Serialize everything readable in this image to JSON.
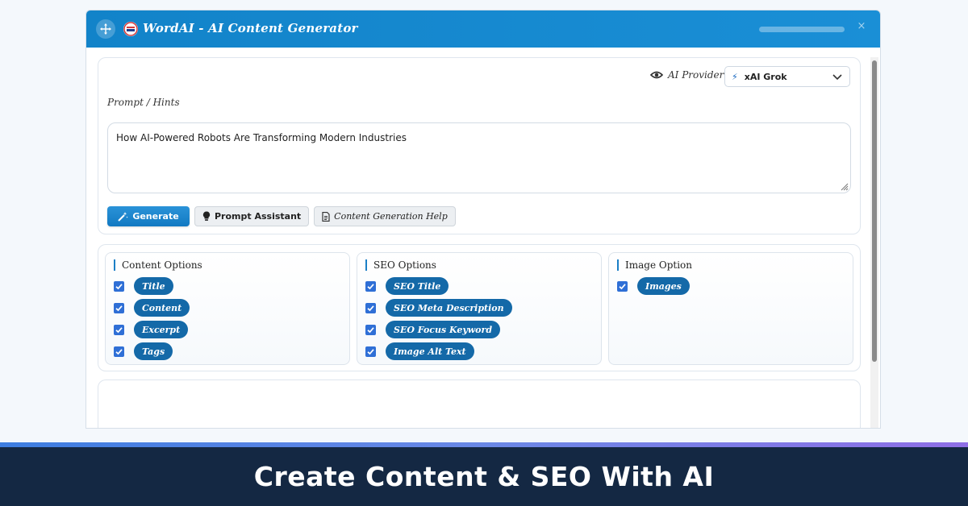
{
  "window": {
    "title": "WordAI - AI Content Generator",
    "close_label": "×",
    "accent_color": "#1283c9"
  },
  "provider": {
    "label": "AI Provider",
    "selected": "xAI Grok"
  },
  "prompt": {
    "label": "Prompt / Hints",
    "value": "How AI-Powered Robots Are Transforming Modern Industries"
  },
  "buttons": {
    "generate": "Generate",
    "prompt_assistant": "Prompt Assistant",
    "help": "Content Generation Help"
  },
  "content_options": {
    "heading": "Content Options",
    "items": [
      {
        "label": "Title",
        "checked": true
      },
      {
        "label": "Content",
        "checked": true
      },
      {
        "label": "Excerpt",
        "checked": true
      },
      {
        "label": "Tags",
        "checked": true
      }
    ]
  },
  "seo_options": {
    "heading": "SEO Options",
    "items": [
      {
        "label": "SEO Title",
        "checked": true
      },
      {
        "label": "SEO Meta Description",
        "checked": true
      },
      {
        "label": "SEO Focus Keyword",
        "checked": true
      },
      {
        "label": "Image Alt Text",
        "checked": true
      }
    ]
  },
  "image_option": {
    "heading": "Image Option",
    "items": [
      {
        "label": "Images",
        "checked": true
      }
    ]
  },
  "banner": {
    "text": "Create Content & SEO With AI"
  }
}
